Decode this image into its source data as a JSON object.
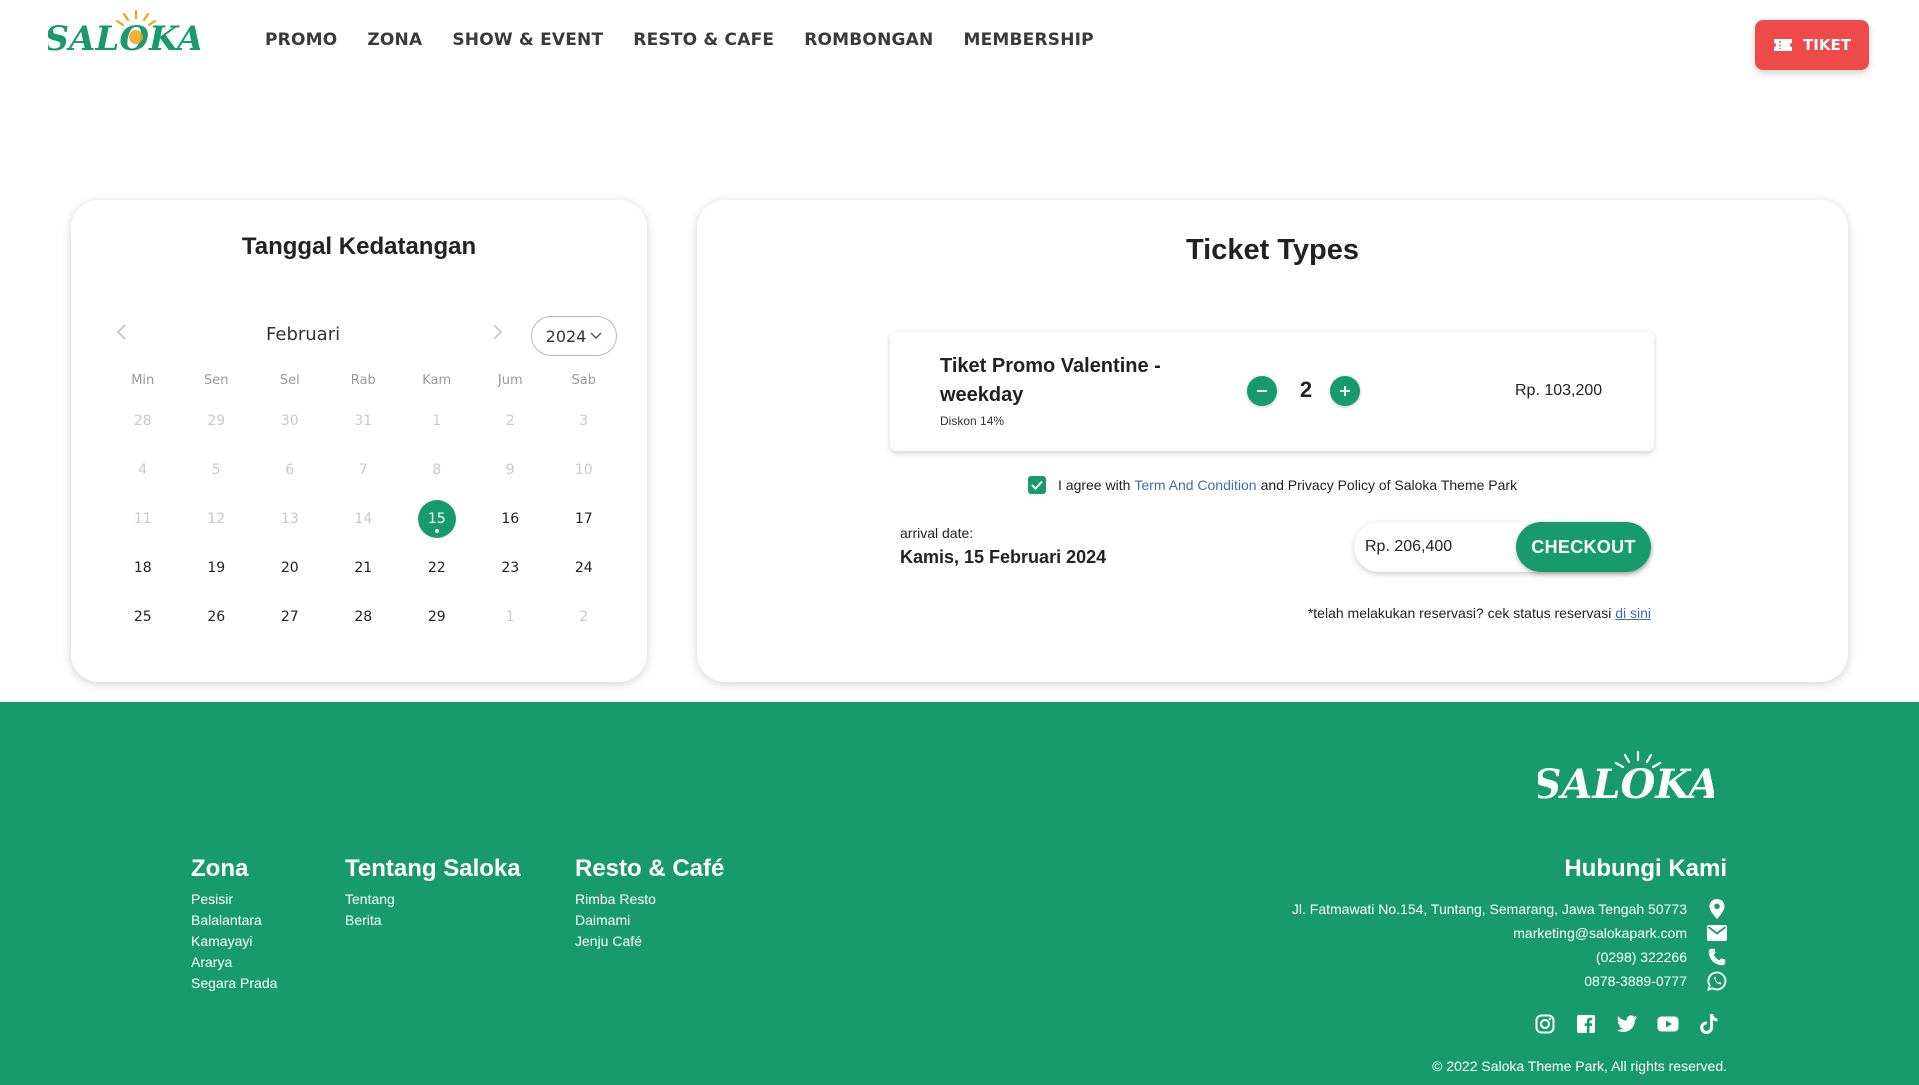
{
  "header": {
    "logo_text": "SALOKA",
    "nav": [
      "PROMO",
      "ZONA",
      "SHOW & EVENT",
      "RESTO & CAFE",
      "ROMBONGAN",
      "MEMBERSHIP"
    ],
    "ticket_button": "TIKET"
  },
  "calendar": {
    "title": "Tanggal Kedatangan",
    "month": "Februari",
    "year": "2024",
    "weekdays": [
      "Min",
      "Sen",
      "Sel",
      "Rab",
      "Kam",
      "Jum",
      "Sab"
    ],
    "weeks": [
      [
        {
          "d": "28",
          "muted": true
        },
        {
          "d": "29",
          "muted": true
        },
        {
          "d": "30",
          "muted": true
        },
        {
          "d": "31",
          "muted": true
        },
        {
          "d": "1",
          "muted": true
        },
        {
          "d": "2",
          "muted": true
        },
        {
          "d": "3",
          "muted": true
        }
      ],
      [
        {
          "d": "4",
          "muted": true
        },
        {
          "d": "5",
          "muted": true
        },
        {
          "d": "6",
          "muted": true
        },
        {
          "d": "7",
          "muted": true
        },
        {
          "d": "8",
          "muted": true
        },
        {
          "d": "9",
          "muted": true
        },
        {
          "d": "10",
          "muted": true
        }
      ],
      [
        {
          "d": "11",
          "muted": true
        },
        {
          "d": "12",
          "muted": true
        },
        {
          "d": "13",
          "muted": true
        },
        {
          "d": "14",
          "muted": true
        },
        {
          "d": "15",
          "selected": true
        },
        {
          "d": "16"
        },
        {
          "d": "17"
        }
      ],
      [
        {
          "d": "18"
        },
        {
          "d": "19"
        },
        {
          "d": "20"
        },
        {
          "d": "21"
        },
        {
          "d": "22"
        },
        {
          "d": "23"
        },
        {
          "d": "24"
        }
      ],
      [
        {
          "d": "25"
        },
        {
          "d": "26"
        },
        {
          "d": "27"
        },
        {
          "d": "28"
        },
        {
          "d": "29"
        },
        {
          "d": "1",
          "muted": true
        },
        {
          "d": "2",
          "muted": true
        }
      ]
    ]
  },
  "tickets": {
    "title": "Ticket Types",
    "item": {
      "name": "Tiket Promo Valentine - weekday",
      "discount": "Diskon 14%",
      "quantity": "2",
      "price": "Rp. 103,200"
    },
    "agree": {
      "prefix": "I agree with",
      "link": "Term And Condition",
      "suffix": "and Privacy Policy of Saloka Theme Park",
      "checked": true
    },
    "arrival_label": "arrival date:",
    "arrival_value": "Kamis, 15 Februari 2024",
    "total": "Rp. 206,400",
    "checkout": "CHECKOUT",
    "reserve_note": "*telah melakukan reservasi? cek status reservasi",
    "reserve_link": "di sini"
  },
  "footer": {
    "logo_text": "SALOKA",
    "columns": [
      {
        "title": "Zona",
        "links": [
          "Pesisir",
          "Balalantara",
          "Kamayayi",
          "Ararya",
          "Segara Prada"
        ]
      },
      {
        "title": "Tentang Saloka",
        "links": [
          "Tentang",
          "Berita"
        ]
      },
      {
        "title": "Resto & Café",
        "links": [
          "Rimba Resto",
          "Daimami",
          "Jenju Café"
        ]
      }
    ],
    "contact_title": "Hubungi Kami",
    "address": "Jl. Fatmawati No.154, Tuntang, Semarang, Jawa Tengah 50773",
    "email": "marketing@salokapark.com",
    "phone": "(0298) 322266",
    "whatsapp": "0878-3889-0777",
    "socials": [
      "instagram-icon",
      "facebook-icon",
      "twitter-icon",
      "youtube-icon",
      "tiktok-icon"
    ],
    "copyright": "© 2022 Saloka Theme Park, All rights reserved."
  },
  "colors": {
    "brand_green": "#179b6d",
    "ticket_red": "#ef4a4a",
    "link_blue": "#3d6fb0"
  }
}
